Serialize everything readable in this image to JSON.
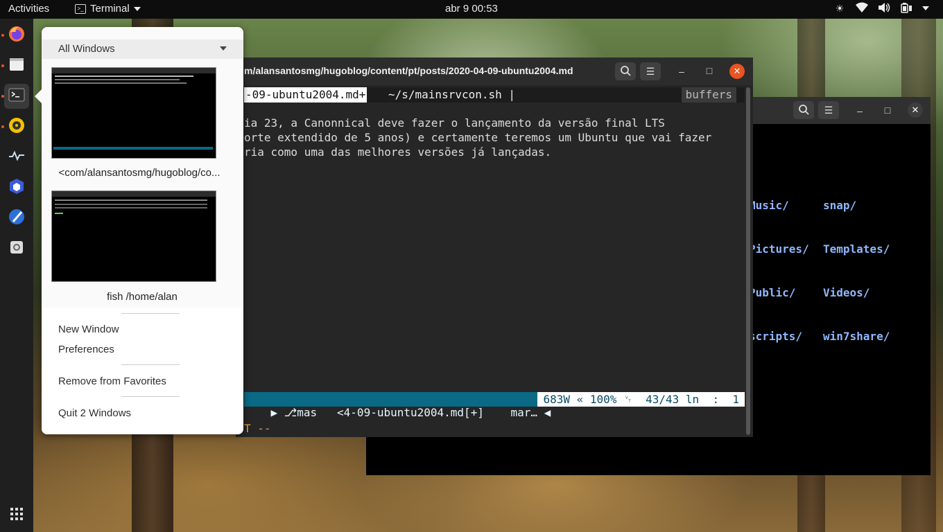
{
  "topbar": {
    "activities": "Activities",
    "app_name": "Terminal",
    "clock": "abr 9  00:53"
  },
  "terminal_back": {
    "lines": [
      [
        "Music/",
        "snap/"
      ],
      [
        "Pictures/",
        "Templates/"
      ],
      [
        "Public/",
        "Videos/"
      ],
      [
        "scripts/",
        "win7share/"
      ]
    ]
  },
  "terminal_front": {
    "title": "m/alansantosmg/hugoblog/content/pt/posts/2020-04-09-ubuntu2004.md",
    "tab_current": "-09-ubuntu2004.md+",
    "tab_other": "~/s/mainsrvcon.sh |",
    "tab_buffers": "buffers",
    "text_lines": [
      "ia 23, a Canonnical deve fazer o lançamento da versão final LTS",
      "orte extendido de 5 anos) e certamente teremos um Ubuntu que vai fazer",
      "ria como uma das melhores versões já lançadas."
    ],
    "status_left": "▶ ⎇mas   <4-09-ubuntu2004.md[+]    mar… ◀",
    "status_right": "683W « 100% ␋  43/43 ln  :  1",
    "modeline": "T --"
  },
  "popover": {
    "filter_label": "All Windows",
    "windows": [
      {
        "caption": "<com/alansantosmg/hugoblog/co..."
      },
      {
        "caption": "fish /home/alan"
      }
    ],
    "menu": {
      "new_window": "New Window",
      "preferences": "Preferences",
      "remove_favorites": "Remove from Favorites",
      "quit": "Quit 2 Windows"
    }
  },
  "colors": {
    "accent": "#e95420",
    "status_bar": "#0a6a86",
    "close_button": "#e95420"
  }
}
